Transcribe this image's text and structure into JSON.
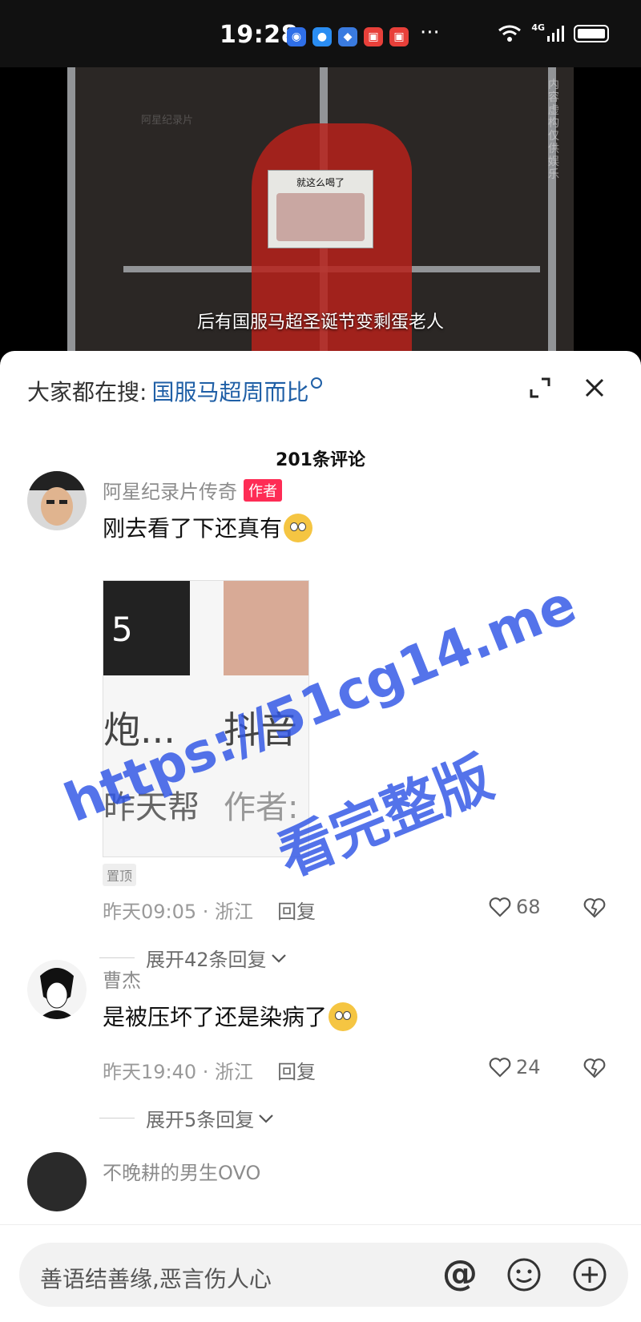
{
  "status_bar": {
    "time": "19:28",
    "more": "···",
    "network": "4G"
  },
  "video": {
    "sticker_text": "就这么喝了",
    "watermark": "阿星纪录片",
    "side_text": "内容虚构 仅供娱乐",
    "subtitle": "后有国服马超圣诞节变剩蛋老人"
  },
  "sheet": {
    "search_prefix": "大家都在搜:",
    "search_term": "国服马超周而比",
    "comment_count": "201条评论"
  },
  "comments": [
    {
      "username": "阿星纪录片传奇",
      "author_tag": "作者",
      "text": "刚去看了下还真有",
      "emoji": "pleading-face-emoji",
      "attachment": {
        "num": "5",
        "t1": "炮...",
        "t2": "抖音",
        "t3": "昨天帮",
        "t4": "作者:"
      },
      "pinned": "置顶",
      "time_loc": "昨天09:05 · 浙江",
      "reply": "回复",
      "likes": "68",
      "expand": "展开42条回复"
    },
    {
      "username": "曹杰",
      "text": "是被压坏了还是染病了",
      "emoji": "flushed-face-emoji",
      "time_loc": "昨天19:40 · 浙江",
      "reply": "回复",
      "likes": "24",
      "expand": "展开5条回复"
    },
    {
      "username": "不晚耕的男生OVO"
    }
  ],
  "input": {
    "placeholder": "善语结善缘,恶言伤人心",
    "at": "@"
  },
  "overlay": {
    "line1": "https://51cg14.me",
    "line2": "看完整版"
  },
  "colors": {
    "accent_blue": "#1f5fa6",
    "author_red": "#fe2c55",
    "overlay_blue": "#2f55e6"
  }
}
